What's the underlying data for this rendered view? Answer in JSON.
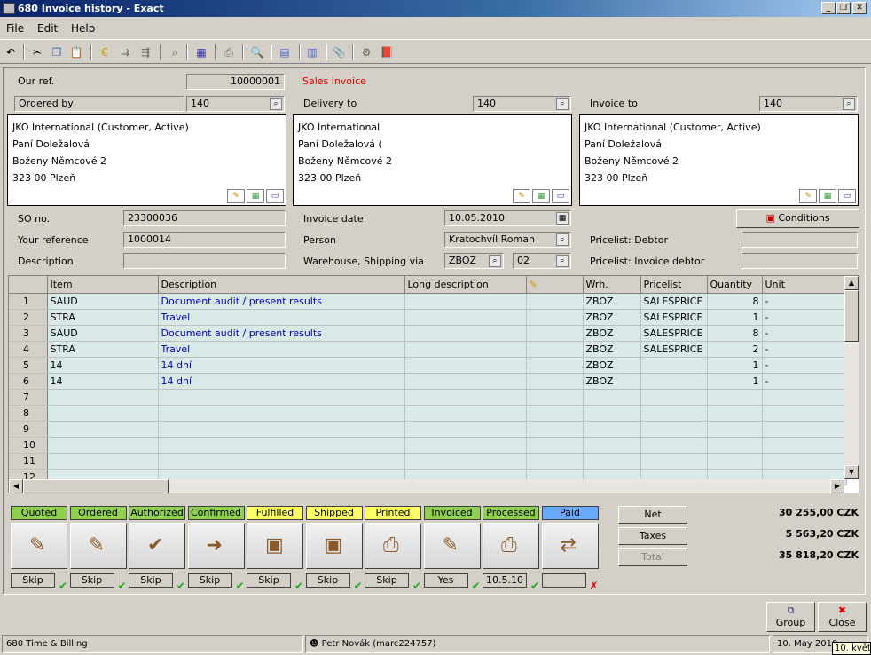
{
  "window": {
    "title": "680 Invoice history - Exact"
  },
  "menu": {
    "file": "File",
    "edit": "Edit",
    "help": "Help"
  },
  "header": {
    "our_ref_label": "Our ref.",
    "our_ref": "10000001",
    "doc_type": "Sales invoice",
    "ordered_by_label": "Ordered by",
    "ordered_by": "140",
    "delivery_to_label": "Delivery to",
    "delivery_to": "140",
    "invoice_to_label": "Invoice to",
    "invoice_to": "140"
  },
  "addresses": [
    {
      "line1": "JKO International (Customer, Active)",
      "line2": "Paní Doležalová",
      "line3": "Boženy Němcové 2",
      "line4": "323 00  Plzeň"
    },
    {
      "line1": "JKO International",
      "line2": "Paní Doležalová (",
      "line3": "Boženy Němcové 2",
      "line4": "323 00  Plzeň"
    },
    {
      "line1": "JKO International (Customer, Active)",
      "line2": "Paní Doležalová",
      "line3": "Boženy Němcové 2",
      "line4": "323 00  Plzeň"
    }
  ],
  "info": {
    "so_label": "SO no.",
    "so": "23300036",
    "your_ref_label": "Your reference",
    "your_ref": "1000014",
    "desc_label": "Description",
    "desc": "",
    "inv_date_label": "Invoice date",
    "inv_date": "10.05.2010",
    "person_label": "Person",
    "person": "Kratochvíl Roman",
    "wh_label": "Warehouse, Shipping via",
    "wh": "ZBOZ",
    "ship": "02",
    "conditions": "Conditions",
    "pl_debtor_label": "Pricelist: Debtor",
    "pl_debtor": "",
    "pl_inv_label": "Pricelist: Invoice debtor",
    "pl_inv": ""
  },
  "grid": {
    "headers": {
      "item": "Item",
      "description": "Description",
      "long": "Long description",
      "wrh": "Wrh.",
      "pricelist": "Pricelist",
      "quantity": "Quantity",
      "unit": "Unit"
    },
    "rows": [
      {
        "n": "1",
        "item": "SAUD",
        "desc": "Document audit / present results",
        "wrh": "ZBOZ",
        "pl": "SALESPRICE",
        "qty": "8",
        "unit": "-"
      },
      {
        "n": "2",
        "item": "STRA",
        "desc": "Travel",
        "wrh": "ZBOZ",
        "pl": "SALESPRICE",
        "qty": "1",
        "unit": "-"
      },
      {
        "n": "3",
        "item": "SAUD",
        "desc": "Document audit / present results",
        "wrh": "ZBOZ",
        "pl": "SALESPRICE",
        "qty": "8",
        "unit": "-"
      },
      {
        "n": "4",
        "item": "STRA",
        "desc": "Travel",
        "wrh": "ZBOZ",
        "pl": "SALESPRICE",
        "qty": "2",
        "unit": "-"
      },
      {
        "n": "5",
        "item": "14",
        "desc": "14 dní",
        "wrh": "ZBOZ",
        "pl": "",
        "qty": "1",
        "unit": "-"
      },
      {
        "n": "6",
        "item": "14",
        "desc": "14 dní",
        "wrh": "ZBOZ",
        "pl": "",
        "qty": "1",
        "unit": "-"
      },
      {
        "n": "7",
        "item": "",
        "desc": "",
        "wrh": "",
        "pl": "",
        "qty": "",
        "unit": ""
      },
      {
        "n": "8",
        "item": "",
        "desc": "",
        "wrh": "",
        "pl": "",
        "qty": "",
        "unit": ""
      },
      {
        "n": "9",
        "item": "",
        "desc": "",
        "wrh": "",
        "pl": "",
        "qty": "",
        "unit": ""
      },
      {
        "n": "10",
        "item": "",
        "desc": "",
        "wrh": "",
        "pl": "",
        "qty": "",
        "unit": ""
      },
      {
        "n": "11",
        "item": "",
        "desc": "",
        "wrh": "",
        "pl": "",
        "qty": "",
        "unit": ""
      },
      {
        "n": "12",
        "item": "",
        "desc": "",
        "wrh": "",
        "pl": "",
        "qty": "",
        "unit": ""
      }
    ]
  },
  "stages": [
    {
      "label": "Quoted",
      "value": "Skip",
      "done": true
    },
    {
      "label": "Ordered",
      "value": "Skip",
      "done": true
    },
    {
      "label": "Authorized",
      "value": "Skip",
      "done": true
    },
    {
      "label": "Confirmed",
      "value": "Skip",
      "done": true
    },
    {
      "label": "Fulfilled",
      "value": "Skip",
      "done": true
    },
    {
      "label": "Shipped",
      "value": "Skip",
      "done": true
    },
    {
      "label": "Printed",
      "value": "Skip",
      "done": true
    },
    {
      "label": "Invoiced",
      "value": "Yes",
      "done": true
    },
    {
      "label": "Processed",
      "value": "10.5.10",
      "done": true
    },
    {
      "label": "Paid",
      "value": "",
      "done": false
    }
  ],
  "totals": {
    "net_label": "Net",
    "net": "30 255,00 CZK",
    "taxes_label": "Taxes",
    "taxes": "5 563,20 CZK",
    "total_label": "Total",
    "total": "35 818,20 CZK"
  },
  "buttons": {
    "group": "Group",
    "close": "Close"
  },
  "statusbar": {
    "module": "680 Time & Billing",
    "user": "Petr Novák (marc224757)",
    "date": "10. May 2010",
    "tooltip": "10. květ"
  },
  "colors": {
    "stage_green": "#8fd14f",
    "stage_yellow": "#ffff66",
    "stage_blue": "#66aaff",
    "row_bg": "#d8e9e8"
  }
}
